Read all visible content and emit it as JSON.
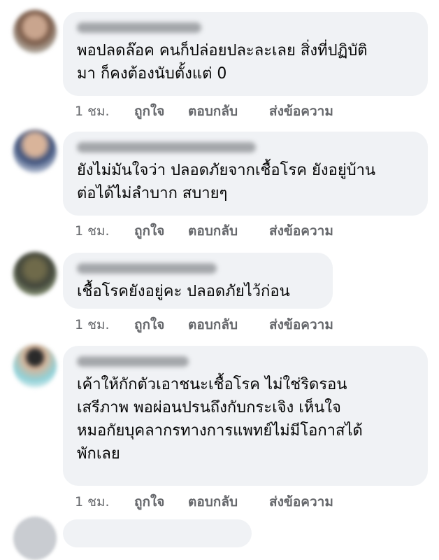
{
  "comments": [
    {
      "text": "พอปลดล๊อค คนก็ปล่อยปละละเลย สิ่งที่ปฏิบัติ\nมา ก็คงต้องนับตั้งแต่ 0",
      "time": "1 ชม.",
      "like_label": "ถูกใจ",
      "reply_label": "ตอบกลับ",
      "more_label": "ส่งข้อความ"
    },
    {
      "text": "ยังไม่มันใจว่า ปลอดภัยจากเชื้อโรค ยังอยู่บ้าน\nต่อได้ไม่ลำบาก สบายๆ",
      "time": "1 ชม.",
      "like_label": "ถูกใจ",
      "reply_label": "ตอบกลับ",
      "more_label": "ส่งข้อความ"
    },
    {
      "text": "เชื้อโรคยังอยู่คะ ปลอดภัยไว้ก่อน",
      "time": "1 ชม.",
      "like_label": "ถูกใจ",
      "reply_label": "ตอบกลับ",
      "more_label": "ส่งข้อความ"
    },
    {
      "text": "เค้าให้กักตัวเอาชนะเชื้อโรค ไม่ใช่ริดรอน\nเสรีภาพ พอผ่อนปรนถึงกับกระเจิง เห็นใจ\nหมอกัยบุคลากรทางการแพทย์ไม่มีโอกาสได้\nพักเลย",
      "time": "1 ชม.",
      "like_label": "ถูกใจ",
      "reply_label": "ตอบกลับ",
      "more_label": "ส่งข้อความ"
    }
  ],
  "colors": {
    "bubble": "#f0f2f5",
    "secondary_text": "#65676b",
    "primary_text": "#050505"
  }
}
